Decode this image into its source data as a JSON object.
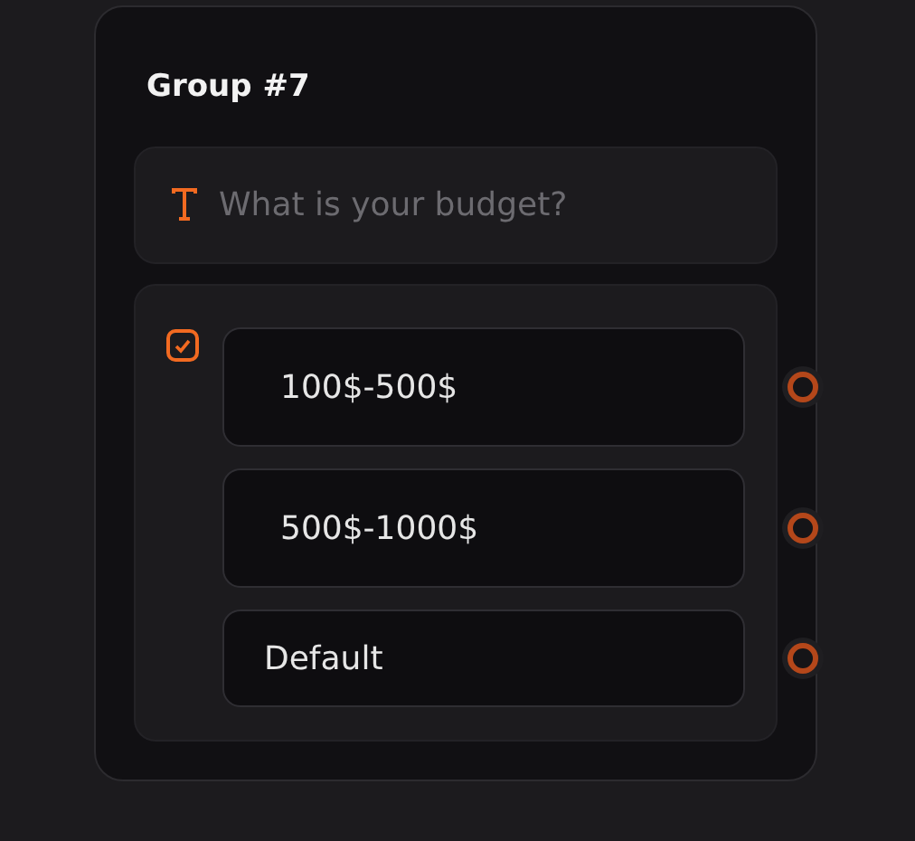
{
  "group": {
    "title": "Group #7"
  },
  "question": {
    "placeholder": "What is your budget?"
  },
  "options_panel": {
    "checked": true
  },
  "options": [
    {
      "kind": "option",
      "label": "100$-500$"
    },
    {
      "kind": "option",
      "label": "500$-1000$"
    },
    {
      "kind": "default",
      "label": "Default"
    }
  ]
}
